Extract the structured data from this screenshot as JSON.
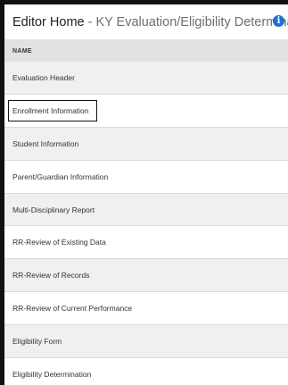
{
  "header": {
    "title_main": "Editor Home",
    "title_sub": "- KY Evaluation/Eligibility Determination",
    "info_icon": "i"
  },
  "table": {
    "column_header": "NAME",
    "rows": [
      {
        "label": "Evaluation Header"
      },
      {
        "label": "Enrollment Information"
      },
      {
        "label": "Student Information"
      },
      {
        "label": "Parent/Guardian Information"
      },
      {
        "label": "Multi-Disciplinary Report"
      },
      {
        "label": "RR-Review of Existing Data"
      },
      {
        "label": "RR-Review of Records"
      },
      {
        "label": "RR-Review of Current Performance"
      },
      {
        "label": "Eligibility Form"
      },
      {
        "label": "Eligibility Determination"
      }
    ]
  }
}
